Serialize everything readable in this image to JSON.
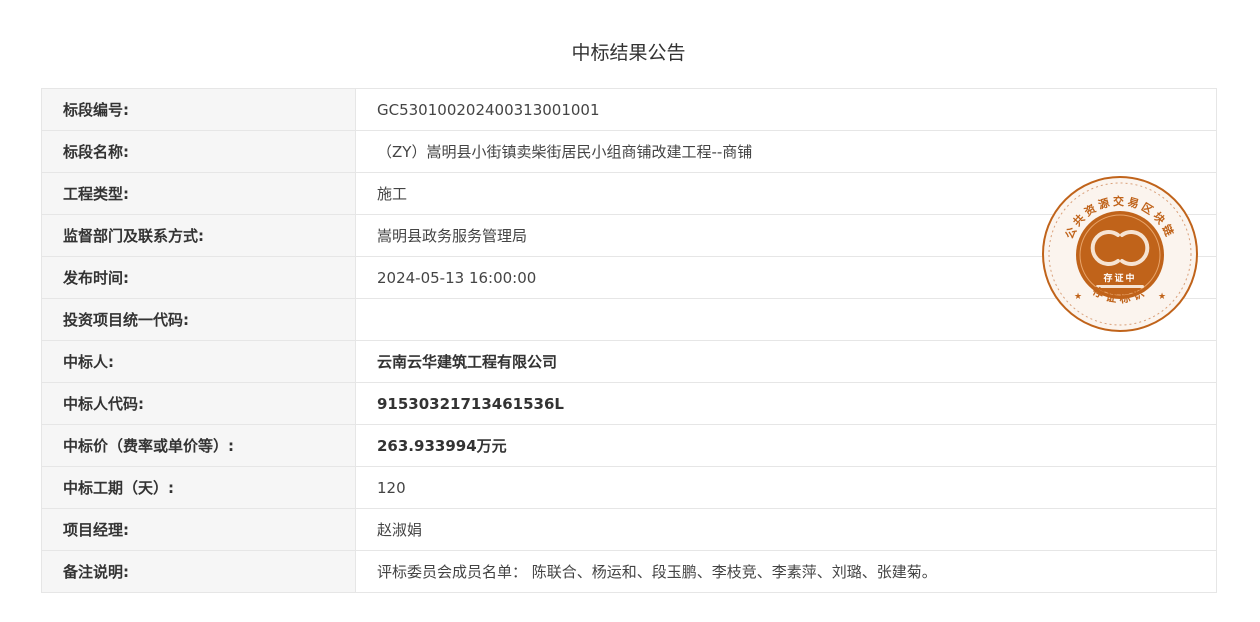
{
  "title": "中标结果公告",
  "rows": [
    {
      "label": "标段编号:",
      "value": "GC5301002024003130010​01"
    },
    {
      "label": "标段名称:",
      "value": "（ZY）嵩明县小街镇卖柴街居民小组商铺改建工程--商铺"
    },
    {
      "label": "工程类型:",
      "value": "施工"
    },
    {
      "label": "监督部门及联系方式:",
      "value": "嵩明县政务服务管理局"
    },
    {
      "label": "发布时间:",
      "value": "2024-05-13 16:00:00"
    },
    {
      "label": "投资项目统一代码:",
      "value": ""
    },
    {
      "label": "中标人:",
      "value": "云南云华建筑工程有限公司"
    },
    {
      "label": "中标人代码:",
      "value": "91530321713461536L"
    },
    {
      "label": "中标价（费率或单价等）:",
      "value": "263.933994万元"
    },
    {
      "label": "中标工期（天）:",
      "value": "120"
    },
    {
      "label": "项目经理:",
      "value": "赵淑娟"
    },
    {
      "label": "备注说明:",
      "value": "评标委员会成员名单： 陈联合、杨运和、段玉鹏、李枝竞、李素萍、刘璐、张建菊。"
    }
  ],
  "seal": {
    "ring_text": "公共资源交易区块链",
    "center_text": "存证中",
    "bottom_text": "存证标识",
    "color": "#c0631a"
  }
}
